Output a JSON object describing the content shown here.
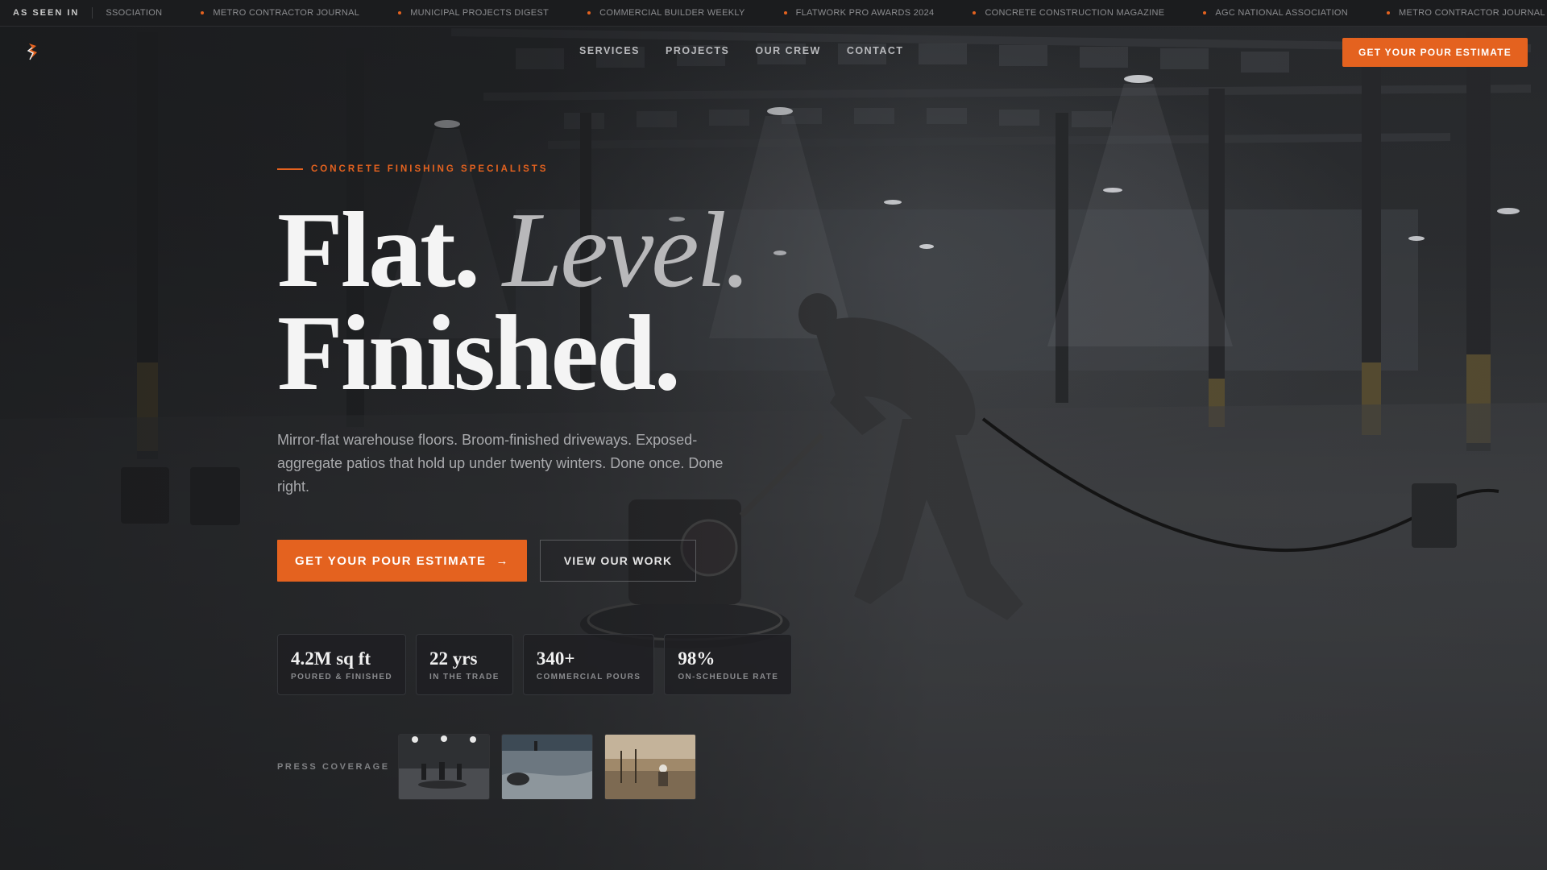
{
  "ticker": {
    "label": "AS SEEN IN",
    "items": [
      "SSOCIATION",
      "METRO CONTRACTOR JOURNAL",
      "MUNICIPAL PROJECTS DIGEST",
      "COMMERCIAL BUILDER WEEKLY",
      "FLATWORK PRO AWARDS 2024",
      "CONCRETE CONSTRUCTION MAGAZINE",
      "AGC NATIONAL ASSOCIATION",
      "METRO CONTRACTOR JOURNAL"
    ]
  },
  "nav": {
    "logo_icon": "trowel-flame-logo",
    "links": [
      "SERVICES",
      "PROJECTS",
      "OUR CREW",
      "CONTACT"
    ],
    "cta": "GET YOUR POUR ESTIMATE"
  },
  "hero": {
    "eyebrow": "CONCRETE FINISHING SPECIALISTS",
    "headline_part1": "Flat.",
    "headline_part2": "Level.",
    "headline_part3": "Finished.",
    "lede": "Mirror-flat warehouse floors. Broom-finished driveways. Exposed-aggregate patios that hold up under twenty winters. Done once. Done right.",
    "primary_cta": "GET YOUR POUR ESTIMATE",
    "primary_cta_icon": "arrow-right-icon",
    "secondary_cta": "VIEW OUR WORK"
  },
  "stats": [
    {
      "value": "4.2M sq ft",
      "label": "POURED & FINISHED"
    },
    {
      "value": "22 yrs",
      "label": "IN THE TRADE"
    },
    {
      "value": "340+",
      "label": "COMMERCIAL POURS"
    },
    {
      "value": "98%",
      "label": "ON-SCHEDULE RATE"
    }
  ],
  "press": {
    "label": "PRESS COVERAGE",
    "thumbnails": [
      "crew-finishing-floor-photo",
      "polished-slab-photo",
      "site-surveyor-photo"
    ]
  },
  "colors": {
    "accent": "#e4621f",
    "background": "#1c1d1f",
    "headline": "#f4f4f4",
    "headline_italic": "#b8b8ba"
  }
}
